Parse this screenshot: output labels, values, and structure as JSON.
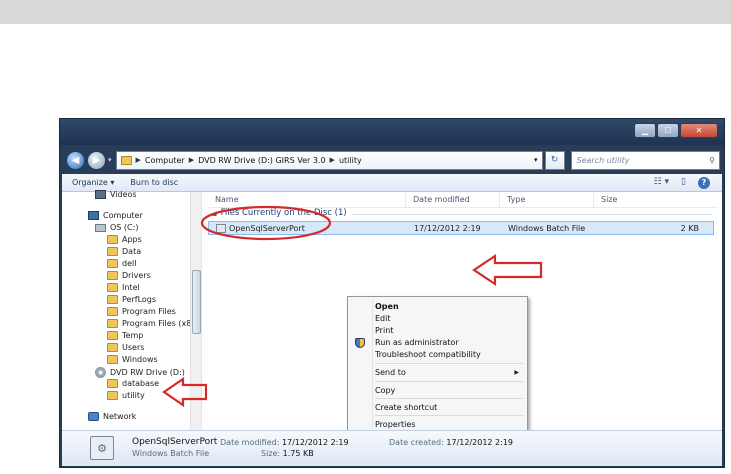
{
  "window": {
    "controls": {
      "minimize": "▁",
      "maximize": "☐",
      "close": "✕"
    }
  },
  "address_bar": {
    "back_icon": "back-arrow-icon",
    "forward_icon": "forward-arrow-icon",
    "crumbs": [
      "Computer",
      "DVD RW Drive (D:) GIRS Ver 3.0",
      "utility"
    ],
    "search_placeholder": "Search utility"
  },
  "toolbar": {
    "organize": "Organize ▾",
    "burn": "Burn to disc"
  },
  "navigation": {
    "items": [
      {
        "label": "Videos",
        "icon": "video-library-icon"
      },
      {
        "label": "Computer",
        "icon": "computer-icon"
      },
      {
        "label": "OS (C:)",
        "icon": "drive-icon"
      },
      {
        "label": "Apps",
        "icon": "folder-icon"
      },
      {
        "label": "Data",
        "icon": "folder-icon"
      },
      {
        "label": "dell",
        "icon": "folder-icon"
      },
      {
        "label": "Drivers",
        "icon": "folder-icon"
      },
      {
        "label": "Intel",
        "icon": "folder-icon"
      },
      {
        "label": "PerfLogs",
        "icon": "folder-icon"
      },
      {
        "label": "Program Files",
        "icon": "folder-icon"
      },
      {
        "label": "Program Files (x8",
        "icon": "folder-icon"
      },
      {
        "label": "Temp",
        "icon": "folder-icon"
      },
      {
        "label": "Users",
        "icon": "folder-icon"
      },
      {
        "label": "Windows",
        "icon": "folder-icon"
      },
      {
        "label": "DVD RW Drive (D:)",
        "icon": "dvd-drive-icon"
      },
      {
        "label": "database",
        "icon": "folder-icon"
      },
      {
        "label": "utility",
        "icon": "folder-icon"
      },
      {
        "label": "Network",
        "icon": "network-icon"
      }
    ]
  },
  "file_list": {
    "columns": [
      "Name",
      "Date modified",
      "Type",
      "Size"
    ],
    "group_label": "Files Currently on the Disc (1)",
    "rows": [
      {
        "name": "OpenSqlServerPort",
        "date": "17/12/2012 2:19",
        "type": "Windows Batch File",
        "size": "2 KB"
      }
    ]
  },
  "context_menu": {
    "items": [
      "Open",
      "Edit",
      "Print",
      "Run as administrator",
      "Troubleshoot compatibility",
      "Send to",
      "Copy",
      "Create shortcut",
      "Properties"
    ]
  },
  "details_pane": {
    "filename": "OpenSqlServerPort",
    "type": "Windows Batch File",
    "date_modified_label": "Date modified:",
    "date_modified": "17/12/2012 2:19",
    "date_created_label": "Date created:",
    "date_created": "17/12/2012 2:19",
    "size_label": "Size:",
    "size": "1.75 KB"
  },
  "annotation_colors": {
    "highlight": "#d42a2a"
  }
}
